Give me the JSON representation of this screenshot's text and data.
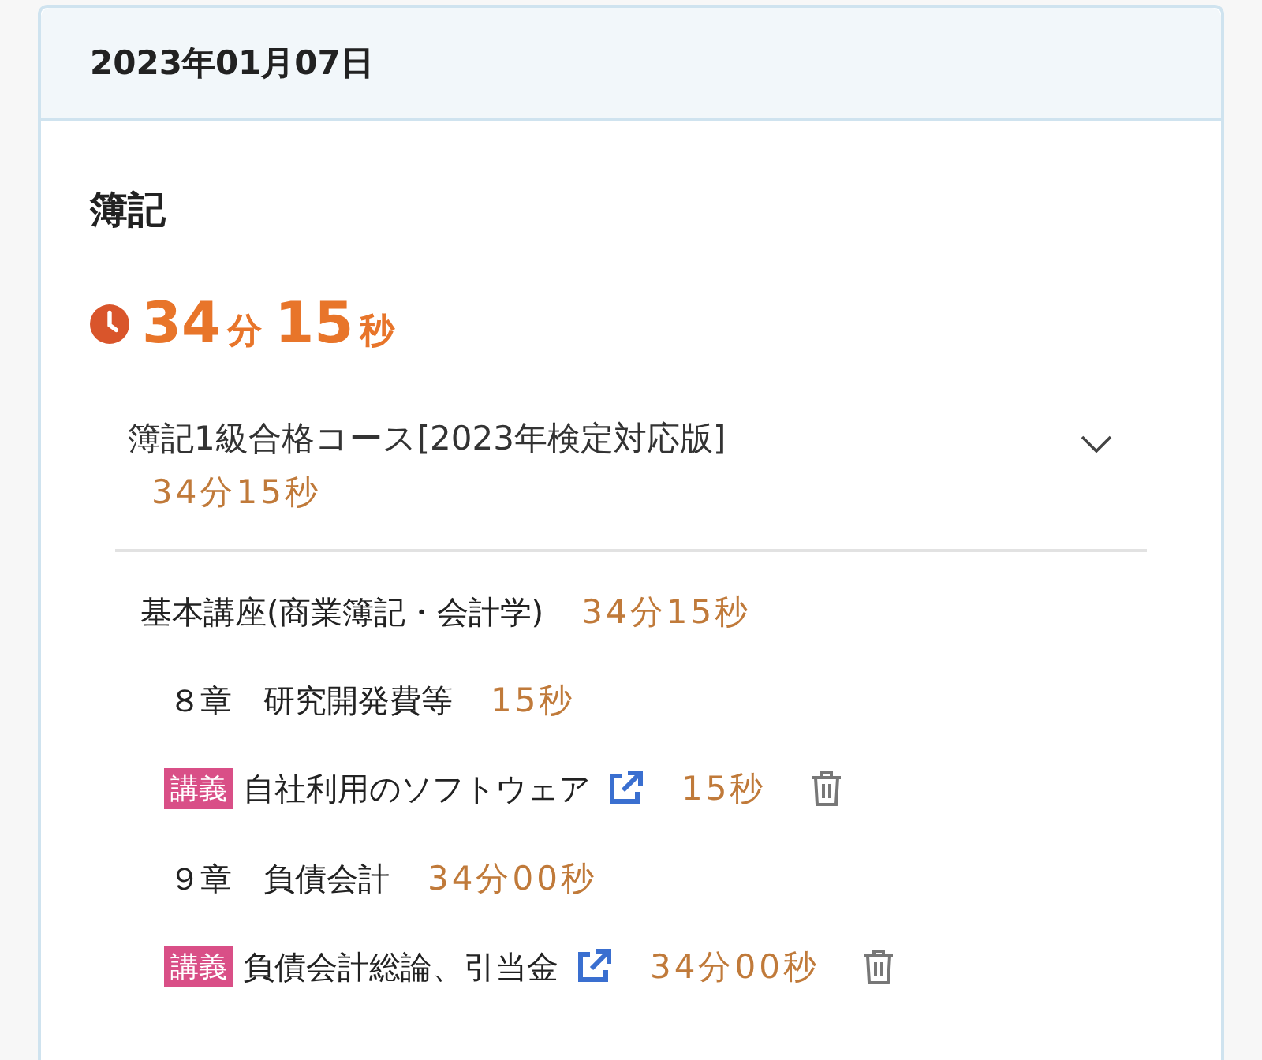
{
  "date": "2023年01月07日",
  "subject": "簿記",
  "total": [
    {
      "kind": "number",
      "text": "34"
    },
    {
      "kind": "unit",
      "text": "分"
    },
    {
      "kind": "number",
      "text": "15"
    },
    {
      "kind": "unit",
      "text": "秒"
    }
  ],
  "course": {
    "title": "簿記1級合格コース[2023年検定対応版]",
    "duration": "34分15秒",
    "expanded": true,
    "children": [
      {
        "title": "基本講座(商業簿記・会計学)",
        "duration": "34分15秒",
        "children": [
          {
            "title": "８章　研究開発費等",
            "duration": "15秒",
            "children": [
              {
                "tag": "講義",
                "title": "自社利用のソフトウェア",
                "duration": "15秒"
              }
            ]
          },
          {
            "title": "９章　負債会計",
            "duration": "34分00秒",
            "children": [
              {
                "tag": "講義",
                "title": "負債会計総論、引当金",
                "duration": "34分00秒"
              }
            ]
          }
        ]
      }
    ]
  }
}
